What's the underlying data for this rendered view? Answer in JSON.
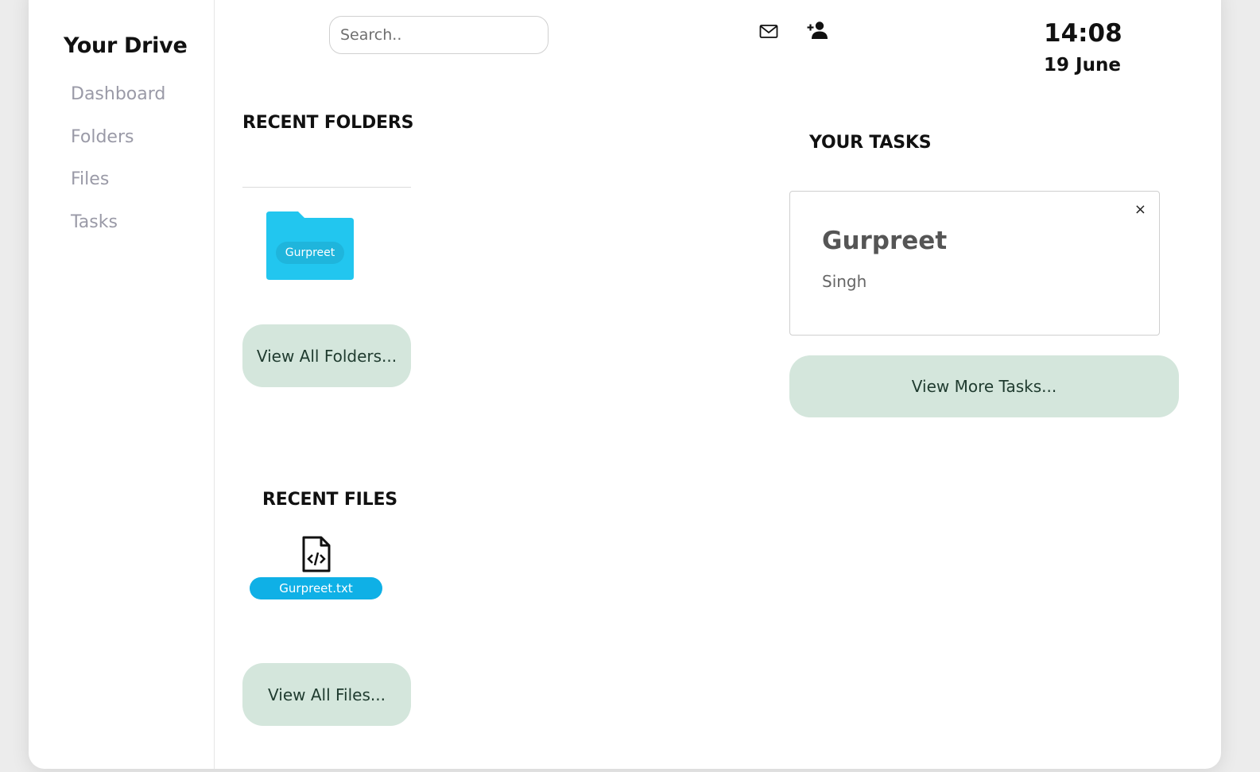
{
  "sidebar": {
    "brand": "Your Drive",
    "items": [
      {
        "label": "Dashboard"
      },
      {
        "label": "Folders"
      },
      {
        "label": "Files"
      },
      {
        "label": "Tasks"
      }
    ]
  },
  "header": {
    "search_placeholder": "Search..",
    "icons": [
      "mail-icon",
      "add-user-icon"
    ],
    "time": "14:08",
    "date": "19 June"
  },
  "recent_folders": {
    "title": "RECENT FOLDERS",
    "folders": [
      {
        "name": "Gurpreet"
      }
    ],
    "view_all_label": "View All Folders..."
  },
  "recent_files": {
    "title": "RECENT FILES",
    "files": [
      {
        "name": "Gurpreet.txt",
        "icon": "code-file-icon"
      }
    ],
    "view_all_label": "View All Files..."
  },
  "tasks": {
    "title": "YOUR TASKS",
    "items": [
      {
        "title": "Gurpreet",
        "subtitle": "Singh",
        "close_symbol": "×"
      }
    ],
    "view_more_label": "View More Tasks..."
  },
  "colors": {
    "folder": "#22c6ef",
    "folder_tab": "#22c6ef",
    "file_label": "#0fb0e6",
    "button_bg": "#d4e6dc",
    "button_text": "#1f3b2f"
  }
}
